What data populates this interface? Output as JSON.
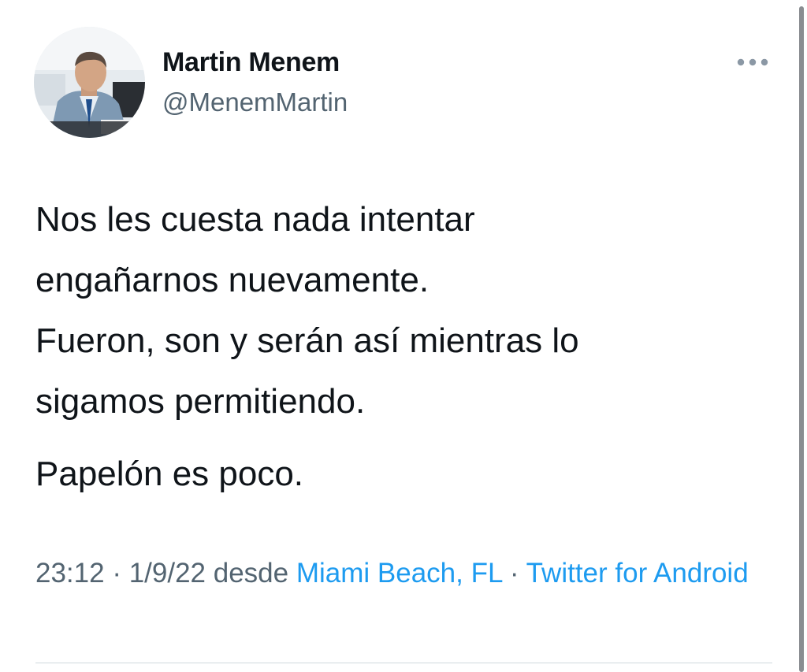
{
  "author": {
    "name": "Martin Menem",
    "handle": "@MenemMartin"
  },
  "tweet": {
    "paragraphs": [
      "Nos les cuesta nada intentar\nengañarnos nuevamente.\nFueron, son y serán así mientras lo\nsigamos permitiendo.",
      "Papelón es poco."
    ],
    "time": "23:12",
    "separator": " · ",
    "date": "1/9/22",
    "from_label": " desde ",
    "location": "Miami Beach, FL",
    "source": "Twitter for Android"
  },
  "icons": {
    "more": "more-horizontal-icon",
    "avatar": "profile-photo"
  },
  "colors": {
    "text": "#0f1419",
    "secondary": "#536471",
    "link": "#1d9bf0",
    "divider": "#cfd9de"
  }
}
